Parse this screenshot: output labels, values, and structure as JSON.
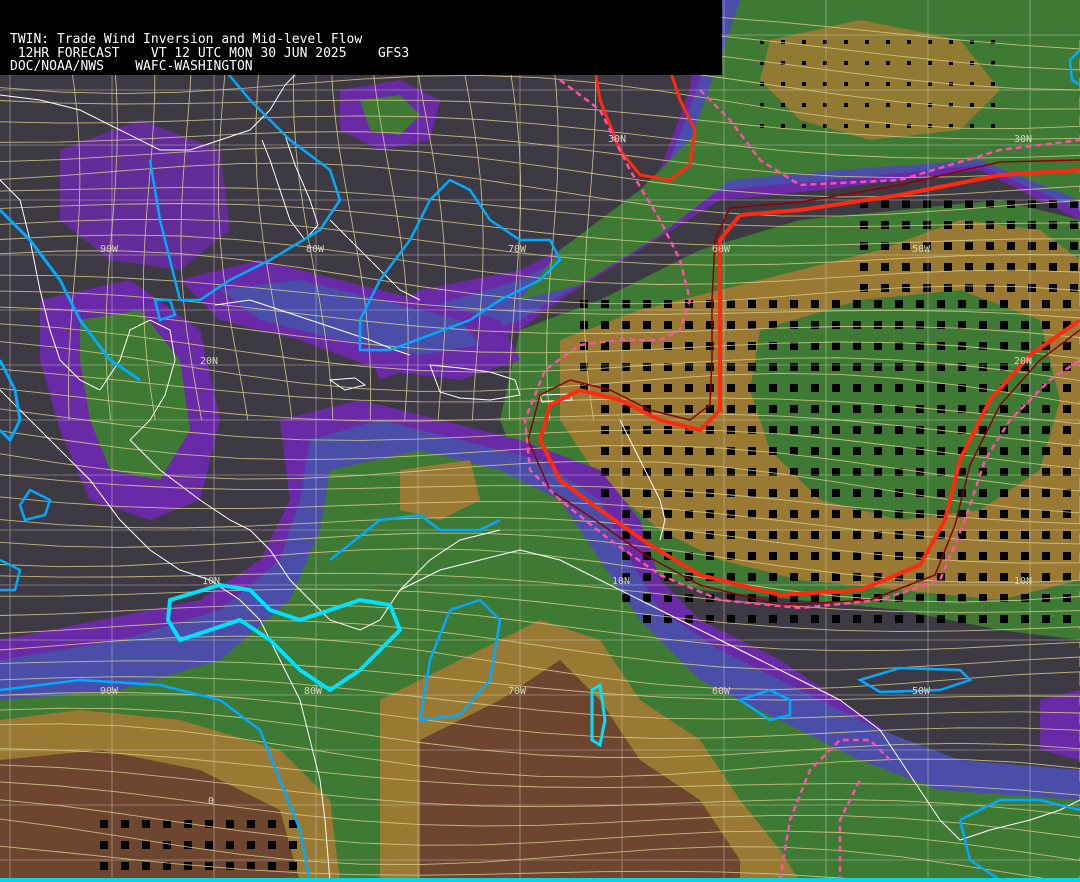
{
  "header": {
    "line1": "TWIN: Trade Wind Inversion and Mid-level Flow",
    "line2": " 12HR FORECAST    VT 12 UTC MON 30 JUN 2025    GFS3",
    "line3": "DOC/NOAA/NWS    WAFC-WASHINGTON"
  },
  "grid_labels": {
    "lat_30": "30N",
    "lat_30_east": "30N",
    "lat_20": "20N",
    "lat_20_east": "20N",
    "lat_10": "10N",
    "lat_10_mid": "10N",
    "lat_10_east": "10N",
    "lon_top": [
      "90W",
      "80W",
      "70W",
      "60W",
      "50W"
    ],
    "lon_bottom": [
      "90W",
      "80W",
      "70W",
      "60W",
      "50W"
    ],
    "lat_0": "0"
  },
  "colors": {
    "background": "#3e3a44",
    "purple_band": "#6a2aa8",
    "blue_band": "#4a4ea8",
    "green_band": "#3f7a34",
    "tan_band": "#9a7a32",
    "brown_band": "#6e4630",
    "contour_cyan": "#00aaff",
    "contour_red": "#ff2a10",
    "contour_pink": "#ff4fa8",
    "streamline": "#d8cf8a",
    "coastline": "#ffffff"
  }
}
